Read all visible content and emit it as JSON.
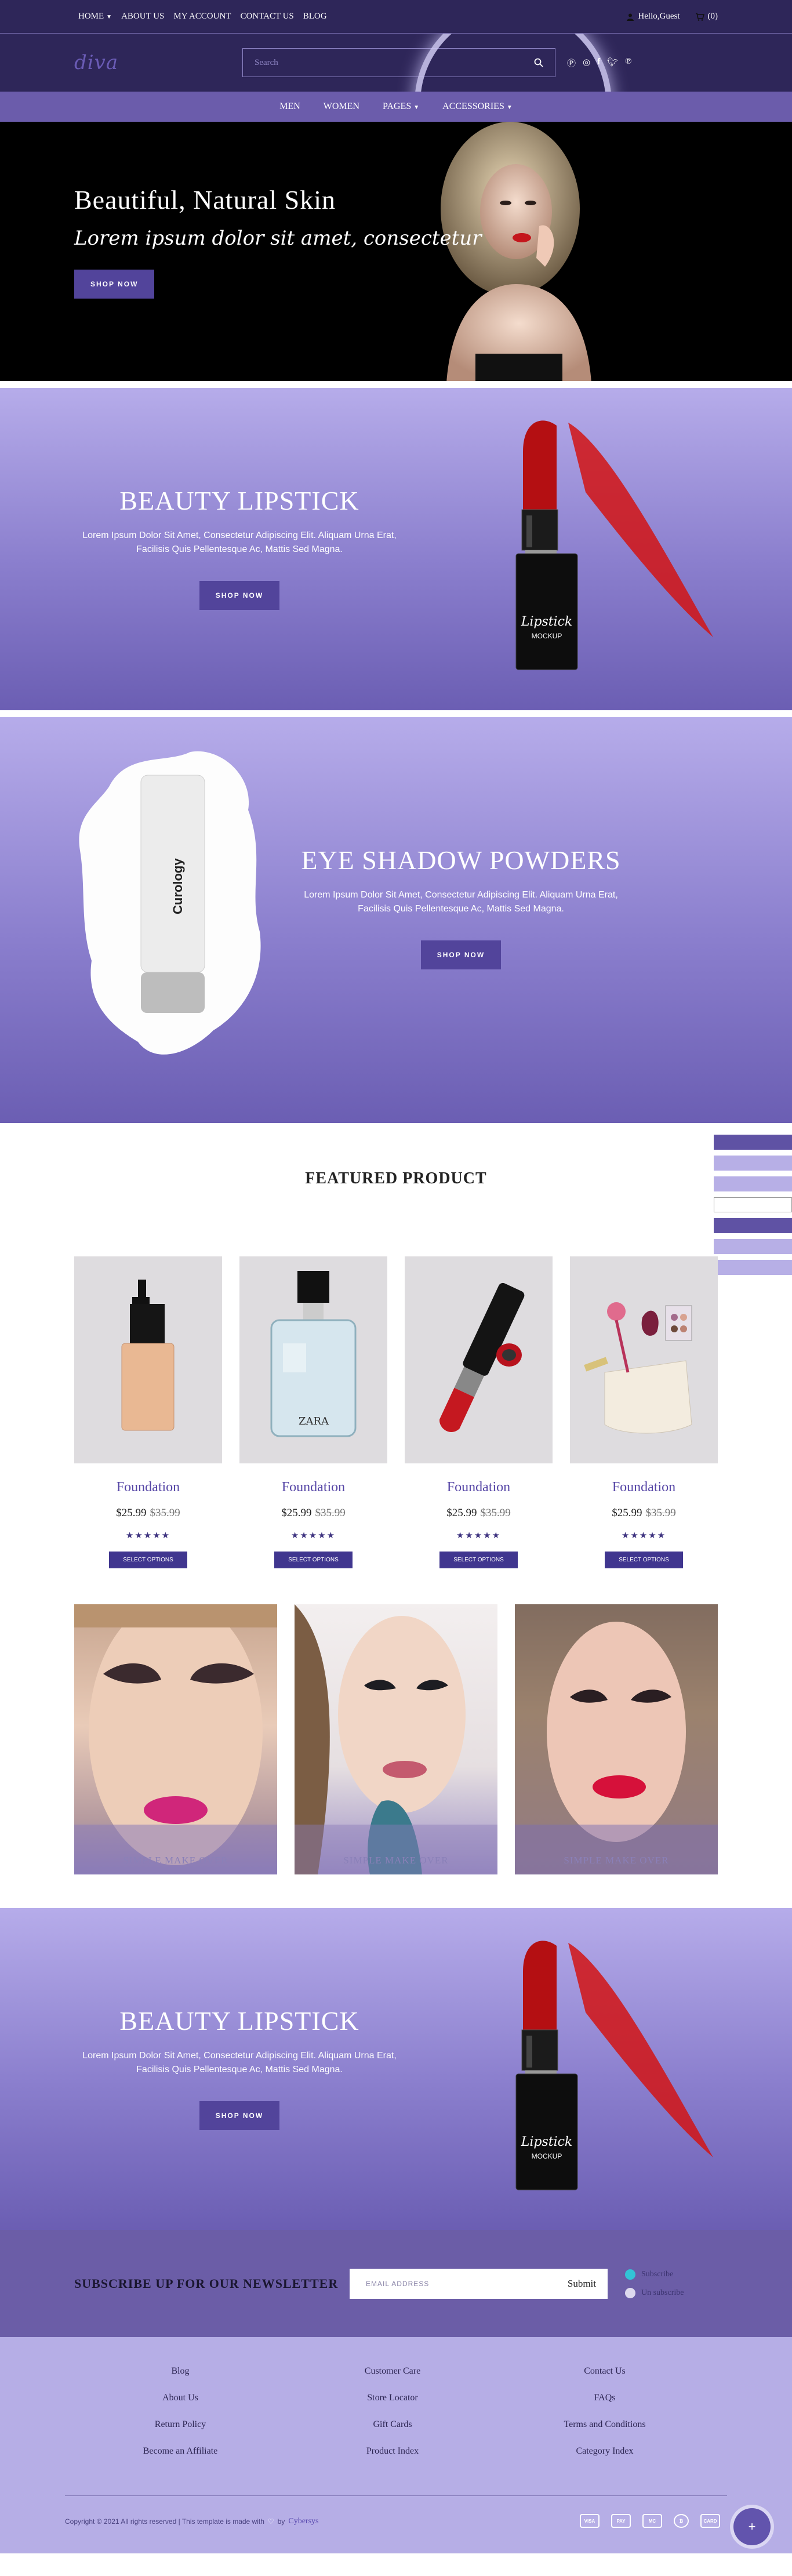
{
  "topbar": {
    "nav": [
      "HOME",
      "ABOUT US",
      "MY ACCOUNT",
      "CONTACT US",
      "BLOG"
    ],
    "greeting": "Hello,Guest",
    "cart": "(0)"
  },
  "header": {
    "logo": "diva",
    "search_placeholder": "Search",
    "social_icons": [
      "pinterest-icon",
      "instagram-icon",
      "facebook-icon",
      "twitter-icon",
      "pinterest-alt-icon"
    ]
  },
  "mainnav": [
    "MEN",
    "WOMEN",
    "PAGES",
    "ACCESSORIES"
  ],
  "hero": {
    "title": "Beautiful, Natural Skin",
    "subtitle": "Lorem ipsum dolor sit amet, consectetur",
    "button": "SHOP NOW"
  },
  "promo1": {
    "title": "BEAUTY LIPSTICK",
    "desc1": "Lorem Ipsum Dolor Sit Amet, Consectetur Adipiscing Elit. Aliquam Urna Erat,",
    "desc2": "Facilisis Quis Pellentesque Ac, Mattis Sed Magna.",
    "button": "SHOP NOW",
    "product_label1": "Lipstick",
    "product_label2": "MOCKUP"
  },
  "promo2": {
    "title": "EYE SHADOW POWDERS",
    "desc1": "Lorem Ipsum Dolor Sit Amet, Consectetur Adipiscing Elit. Aliquam Urna Erat,",
    "desc2": "Facilisis Quis Pellentesque Ac, Mattis Sed Magna.",
    "button": "SHOP NOW",
    "product_label": "Curology"
  },
  "featured": {
    "title": "FEATURED PRODUCT",
    "products": [
      {
        "name": "Foundation",
        "price": "$25.99",
        "old": "$35.99",
        "stars": "★★★★★",
        "button": "SELECT OPTIONS"
      },
      {
        "name": "Foundation",
        "price": "$25.99",
        "old": "$35.99",
        "stars": "★★★★★",
        "button": "SELECT OPTIONS"
      },
      {
        "name": "Foundation",
        "price": "$25.99",
        "old": "$35.99",
        "stars": "★★★★★",
        "button": "SELECT OPTIONS"
      },
      {
        "name": "Foundation",
        "price": "$25.99",
        "old": "$35.99",
        "stars": "★★★★★",
        "button": "SELECT OPTIONS"
      }
    ],
    "perfume_label": "ZARA"
  },
  "tiles": [
    "SIMPLE MAKE OVER",
    "SIMPLE MAKE OVER",
    "SIMPLE MAKE OVER"
  ],
  "promo3": {
    "title": "BEAUTY LIPSTICK",
    "desc1": "Lorem Ipsum Dolor Sit Amet, Consectetur Adipiscing Elit. Aliquam Urna Erat,",
    "desc2": "Facilisis Quis Pellentesque Ac, Mattis Sed Magna.",
    "button": "SHOP NOW",
    "product_label1": "Lipstick",
    "product_label2": "MOCKUP"
  },
  "newsletter": {
    "title": "SUBSCRIBE UP FOR OUR NEWSLETTER",
    "placeholder": "EMAIL ADDRESS",
    "submit": "Submit",
    "radio1": "Subscribe",
    "radio2": "Un subscribe"
  },
  "footer": {
    "col1": [
      "Blog",
      "About Us",
      "Return Policy",
      "Become an Affiliate"
    ],
    "col2": [
      "Customer Care",
      "Store Locator",
      "Gift Cards",
      "Product Index"
    ],
    "col3": [
      "Contact Us",
      "FAQs",
      "Terms and Conditions",
      "Category Index"
    ],
    "copyright": "Copyright © 2021 All rights reserved | This template is made with",
    "by": "by",
    "author": "Cybersys",
    "cards": [
      "VISA",
      "PAY",
      "MC",
      "₿",
      "CARD"
    ]
  },
  "colors": {
    "accent": "#52449b",
    "dark": "#2e2659",
    "nav": "#6b5cab",
    "footer": "#b6aee6"
  }
}
